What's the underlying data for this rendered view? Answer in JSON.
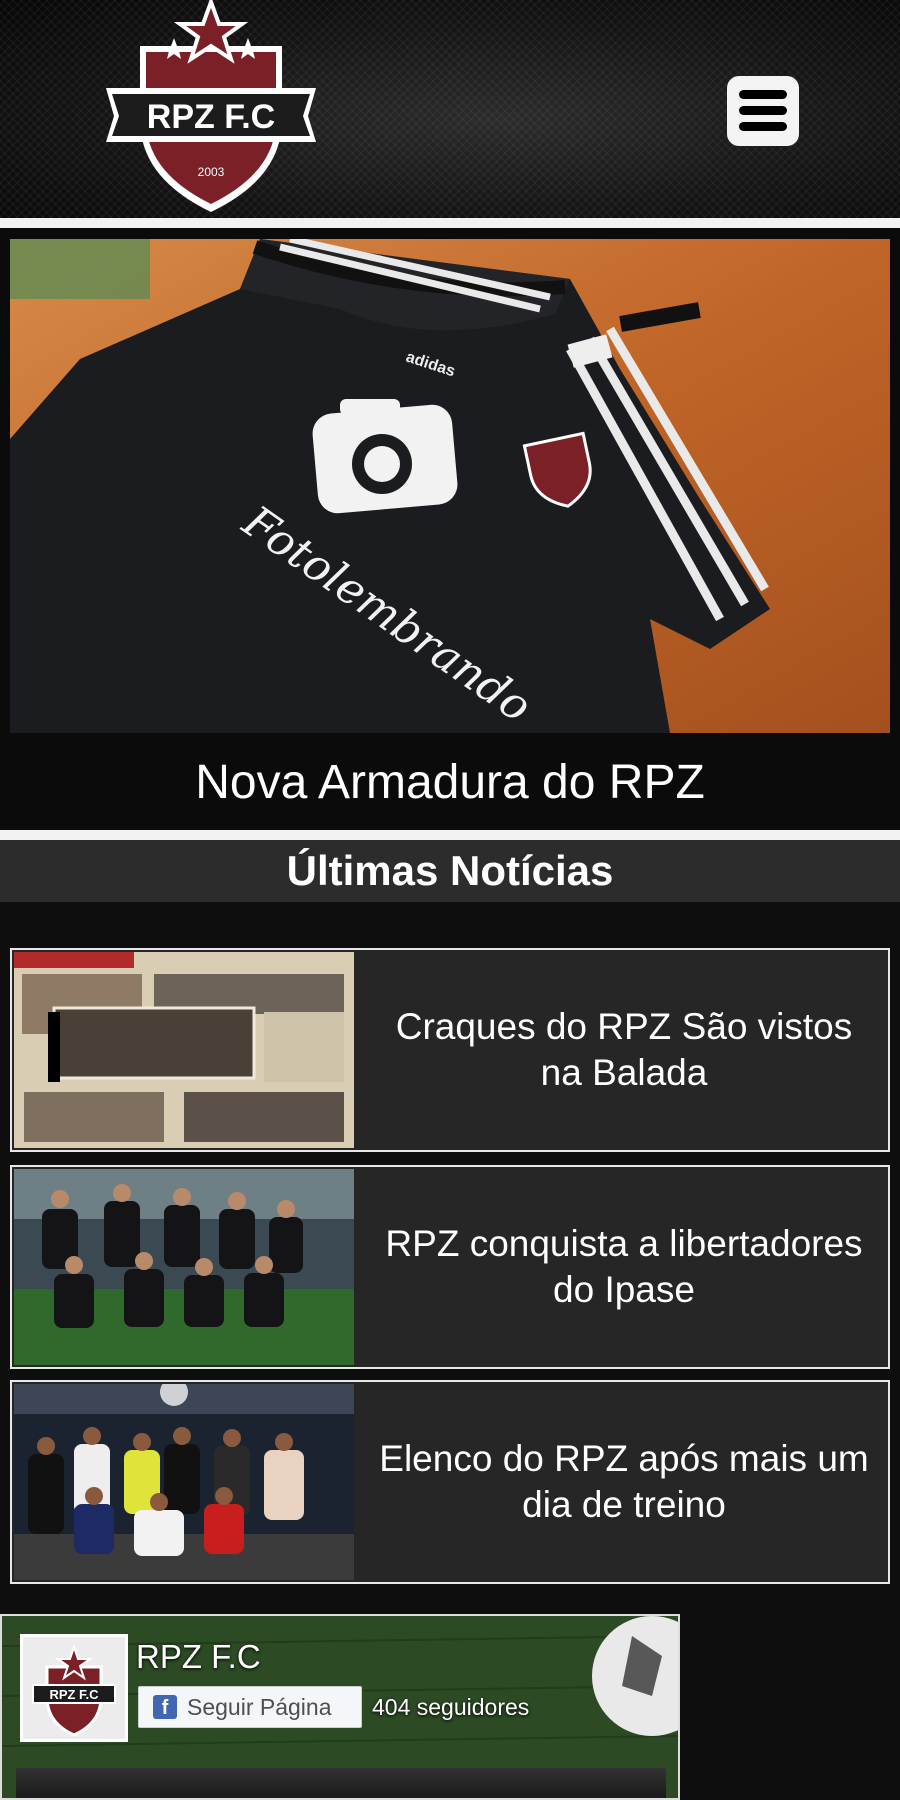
{
  "header": {
    "logo_text": "RPZ F.C",
    "logo_year": "2003",
    "menu_icon": "hamburger-menu-icon"
  },
  "hero": {
    "caption": "Nova Armadura do RPZ",
    "shirt_print": "Fotolembrando",
    "shirt_brand": "adidas"
  },
  "news": {
    "heading": "Últimas Notícias",
    "items": [
      {
        "title": "Craques do RPZ São vistos na Balada"
      },
      {
        "title": "RPZ conquista a libertadores do Ipase"
      },
      {
        "title": "Elenco do RPZ após mais um dia de treino"
      }
    ]
  },
  "facebook": {
    "page_name": "RPZ F.C",
    "follow_label": "Seguir Página",
    "followers": "404 seguidores",
    "icon": "facebook-icon"
  },
  "colors": {
    "brand_red": "#7b2027",
    "background": "#0e0e0e",
    "news_bg": "#262626"
  }
}
